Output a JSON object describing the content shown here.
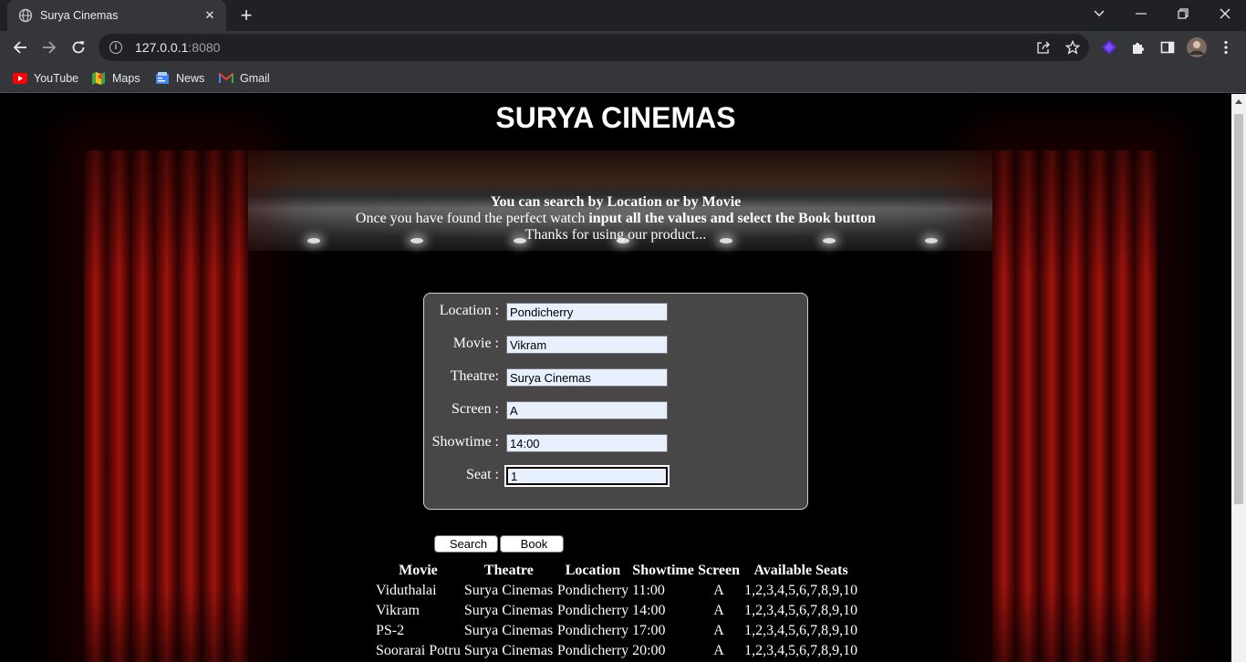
{
  "browser": {
    "tab_title": "Surya Cinemas",
    "url_host": "127.0.0.1",
    "url_port": ":8080",
    "bookmarks": [
      {
        "label": "YouTube",
        "icon": "youtube-icon"
      },
      {
        "label": "Maps",
        "icon": "maps-icon"
      },
      {
        "label": "News",
        "icon": "news-icon"
      },
      {
        "label": "Gmail",
        "icon": "gmail-icon"
      }
    ]
  },
  "page": {
    "title": "SURYA CINEMAS",
    "intro": {
      "line1": "You can search by Location or by Movie",
      "line2_normal": "Once you have found the perfect watch ",
      "line2_bold": "input all the values and select the Book button",
      "line3": "Thanks for using our product..."
    },
    "form": {
      "location_label": "Location :",
      "location_value": "Pondicherry",
      "movie_label": "Movie :",
      "movie_value": "Vikram",
      "theatre_label": "Theatre:",
      "theatre_value": "Surya Cinemas",
      "screen_label": "Screen :",
      "screen_value": "A",
      "showtime_label": "Showtime :",
      "showtime_value": "14:00",
      "seat_label": "Seat :",
      "seat_value": "1"
    },
    "buttons": {
      "search": "Search",
      "book": "Book"
    },
    "table": {
      "headers": [
        "Movie",
        "Theatre",
        "Location",
        "Showtime",
        "Screen",
        "Available Seats"
      ],
      "rows": [
        [
          "Viduthalai",
          "Surya Cinemas",
          "Pondicherry",
          "11:00",
          "A",
          "1,2,3,4,5,6,7,8,9,10"
        ],
        [
          "Vikram",
          "Surya Cinemas",
          "Pondicherry",
          "14:00",
          "A",
          "1,2,3,4,5,6,7,8,9,10"
        ],
        [
          "PS-2",
          "Surya Cinemas",
          "Pondicherry",
          "17:00",
          "A",
          "1,2,3,4,5,6,7,8,9,10"
        ],
        [
          "Soorarai Potru",
          "Surya Cinemas",
          "Pondicherry",
          "20:00",
          "A",
          "1,2,3,4,5,6,7,8,9,10"
        ]
      ]
    }
  }
}
